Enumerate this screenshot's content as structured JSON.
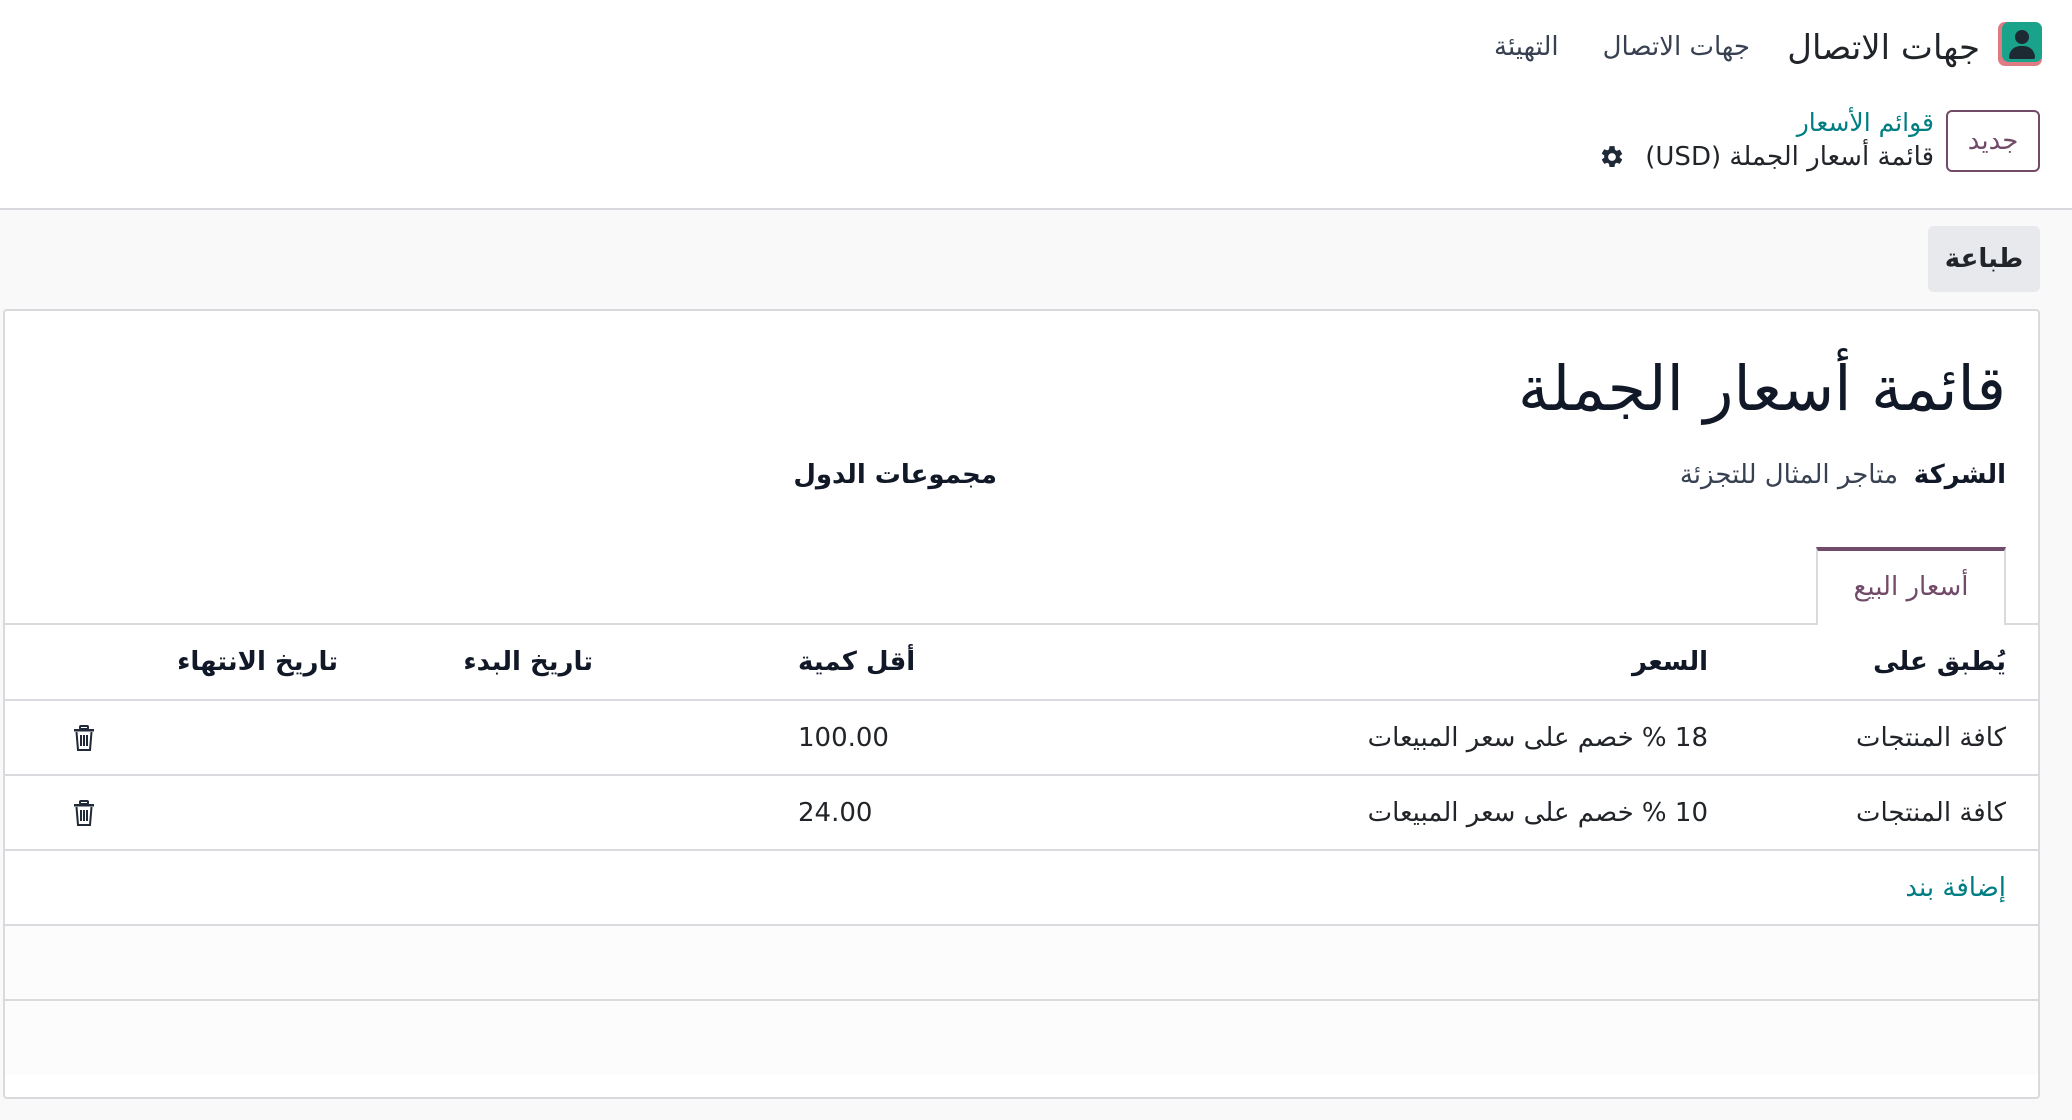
{
  "app": {
    "name": "جهات الاتصال",
    "icon": "contacts-icon",
    "icon_colors": {
      "front": "#1aa38b",
      "back": "#e07a83"
    }
  },
  "nav_menu": [
    {
      "label": "جهات الاتصال"
    },
    {
      "label": "التهيئة"
    }
  ],
  "control_panel": {
    "new_button": "جديد",
    "breadcrumb": "قوائم الأسعار",
    "record_title": "قائمة أسعار الجملة (USD)",
    "gear_icon": "gear-icon"
  },
  "actions": {
    "print_button": "طباعة"
  },
  "form": {
    "title": "قائمة أسعار الجملة",
    "company_label": "الشركة",
    "company_value": "متاجر المثال للتجزئة",
    "country_groups_label": "مجموعات الدول",
    "country_groups_value": ""
  },
  "tabs": [
    {
      "label": "أسعار البيع",
      "active": true
    }
  ],
  "table": {
    "columns": {
      "apply_on": "يُطبق على",
      "price": "السعر",
      "min_qty": "أقل كمية",
      "start_date": "تاريخ البدء",
      "end_date": "تاريخ الانتهاء"
    },
    "rows": [
      {
        "apply_on": "كافة المنتجات",
        "price": "18 % خصم على سعر المبيعات",
        "min_qty": "100.00",
        "start_date": "",
        "end_date": ""
      },
      {
        "apply_on": "كافة المنتجات",
        "price": "10 % خصم على سعر المبيعات",
        "min_qty": "24.00",
        "start_date": "",
        "end_date": ""
      }
    ],
    "add_line": "إضافة بند",
    "delete_icon": "trash-icon"
  },
  "colors": {
    "primary": "#714b67",
    "link": "#017e84",
    "border": "#d8dadd"
  }
}
